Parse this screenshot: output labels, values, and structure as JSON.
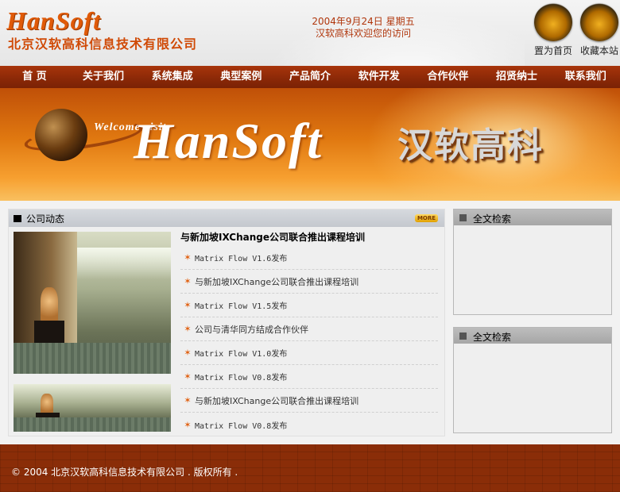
{
  "header": {
    "logo_en": "HanSoft",
    "logo_cn": "北京汉软高科信息技术有限公司",
    "date": "2004年9月24日 星期五",
    "welcome": "汉软高科欢迎您的访问",
    "set_home_label": "置为首页",
    "favorite_label": "收藏本站"
  },
  "nav": {
    "items": [
      "首 页",
      "关于我们",
      "系统集成",
      "典型案例",
      "产品简介",
      "软件开发",
      "合作伙伴",
      "招贤纳士",
      "联系我们"
    ]
  },
  "banner": {
    "welcome": "Welcome visit",
    "brand": "HanSoft",
    "cn_name": "汉软高科"
  },
  "news": {
    "title": "公司动态",
    "more_label": "MORE",
    "featured": "与新加坡IXChange公司联合推出课程培训",
    "items": [
      "Matrix Flow V1.6发布",
      "与新加坡IXChange公司联合推出课程培训",
      "Matrix Flow V1.5发布",
      "公司与清华同方结成合作伙伴",
      "Matrix Flow V1.0发布",
      "Matrix Flow V0.8发布",
      "与新加坡IXChange公司联合推出课程培训",
      "Matrix Flow V0.8发布"
    ]
  },
  "sidebar": {
    "panel1_title": "全文检索",
    "panel2_title": "全文检索"
  },
  "footer": {
    "copyright": "© 2004 北京汉软高科信息技术有限公司 .  版权所有 ."
  },
  "colors": {
    "brand_orange": "#e05a08",
    "nav_bg": "#8a2807",
    "footer_bg": "#8a2d08"
  }
}
